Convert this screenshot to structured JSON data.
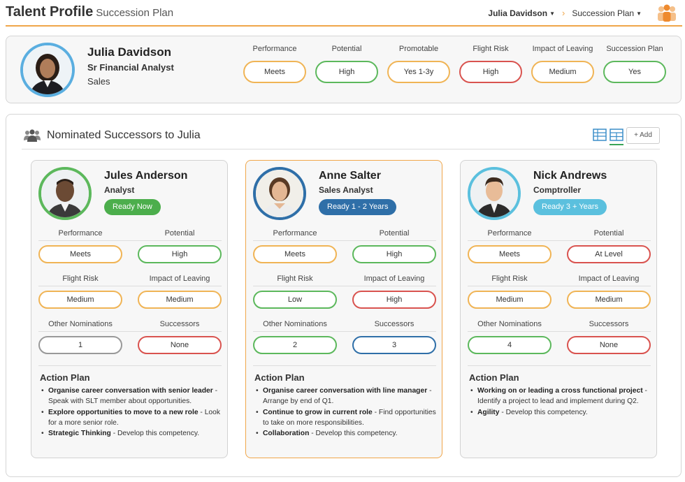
{
  "header": {
    "title": "Talent Profile",
    "subtitle": "Succession Plan",
    "user_menu": "Julia Davidson",
    "section_menu": "Succession Plan",
    "team_icon": "team-people-icon",
    "accent": "#f0a64a"
  },
  "profile": {
    "name": "Julia Davidson",
    "title": "Sr Financial Analyst",
    "department": "Sales",
    "metrics": [
      {
        "label": "Performance",
        "value": "Meets",
        "color": "orange"
      },
      {
        "label": "Potential",
        "value": "High",
        "color": "green"
      },
      {
        "label": "Promotable",
        "value": "Yes 1-3y",
        "color": "orange"
      },
      {
        "label": "Flight Risk",
        "value": "High",
        "color": "red"
      },
      {
        "label": "Impact of Leaving",
        "value": "Medium",
        "color": "orange"
      },
      {
        "label": "Succession Plan",
        "value": "Yes",
        "color": "green"
      }
    ]
  },
  "successors": {
    "title": "Nominated Successors to Julia",
    "add_label": "+ Add",
    "view_icons": [
      "list-view-icon",
      "grid-view-icon"
    ],
    "labels": {
      "performance": "Performance",
      "potential": "Potential",
      "flight_risk": "Flight Risk",
      "impact": "Impact of Leaving",
      "other_nominations": "Other Nominations",
      "successors": "Successors",
      "action_plan": "Action Plan"
    },
    "cards": [
      {
        "name": "Jules Anderson",
        "role": "Analyst",
        "readiness": "Ready Now",
        "readiness_color": "#4cae4c",
        "avatar_ring": "#5cb85c",
        "performance": "Meets",
        "potential": "High",
        "flight_risk": "Medium",
        "impact": "Medium",
        "other_nominations": "1",
        "successors": "None",
        "actions": [
          {
            "strong": "Organise career conversation with senior leader",
            "rest": " - Speak with SLT member about opportunities."
          },
          {
            "strong": "Explore opportunities to move to a new role",
            "rest": " - Look for a more senior role."
          },
          {
            "strong": "Strategic Thinking",
            "rest": " - Develop this competency."
          }
        ]
      },
      {
        "name": "Anne Salter",
        "role": "Sales Analyst",
        "readiness": "Ready 1 - 2 Years",
        "readiness_color": "#2f6fa8",
        "avatar_ring": "#2f6fa8",
        "performance": "Meets",
        "potential": "High",
        "flight_risk": "Low",
        "impact": "High",
        "other_nominations": "2",
        "successors": "3",
        "actions": [
          {
            "strong": "Organise career conversation with line manager",
            "rest": " - Arrange by end of Q1."
          },
          {
            "strong": "Continue to grow in current role",
            "rest": " - Find opportunities to take on more responsibilities."
          },
          {
            "strong": "Collaboration",
            "rest": " - Develop this competency."
          }
        ]
      },
      {
        "name": "Nick Andrews",
        "role": "Comptroller",
        "readiness": "Ready 3 + Years",
        "readiness_color": "#5bc0de",
        "avatar_ring": "#5bc0de",
        "performance": "Meets",
        "potential": "At Level",
        "flight_risk": "Medium",
        "impact": "Medium",
        "other_nominations": "4",
        "successors": "None",
        "actions": [
          {
            "strong": "Working on or leading a cross functional project",
            "rest": " - Identify a project to lead and implement during Q2."
          },
          {
            "strong": "Agility",
            "rest": " - Develop this competency."
          }
        ]
      }
    ]
  }
}
